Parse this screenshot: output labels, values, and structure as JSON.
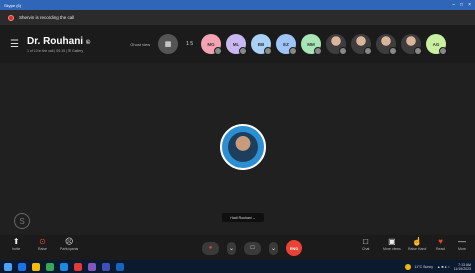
{
  "window": {
    "title": "Skype (6)"
  },
  "recording": {
    "text": "Shervin is recording the call"
  },
  "header": {
    "title": "Dr. Rouhani",
    "title_suffix": "©",
    "subtitle": "1 of 10 in the call | 00:15 | ☰ Gallery",
    "ghost_text": "Ghost view",
    "participant_count": "1 5",
    "avatars": [
      {
        "initials": "MG",
        "color": "#f4a3b5"
      },
      {
        "initials": "ML",
        "color": "#c9b7f2"
      },
      {
        "initials": "BB",
        "color": "#a9d0f5"
      },
      {
        "initials": "EZ",
        "color": "#9fc5f8"
      },
      {
        "initials": "MM",
        "color": "#a8e6b8"
      },
      {
        "initials": "",
        "color": "photo"
      },
      {
        "initials": "",
        "color": "photo"
      },
      {
        "initials": "",
        "color": "photo"
      },
      {
        "initials": "",
        "color": "photo"
      },
      {
        "initials": "AG",
        "color": "#c8f0a0"
      }
    ]
  },
  "stage": {
    "speaker_name": "Hadi Rouhani",
    "speaker_menu": "⌄",
    "brand_letter": "S"
  },
  "controls": {
    "left": [
      {
        "icon": "share-icon",
        "glyph": "⬆",
        "label": "Invite"
      },
      {
        "icon": "react-icon",
        "glyph": "⊙",
        "label": "Raise"
      },
      {
        "icon": "people-icon",
        "glyph": "☹",
        "label": "Participants"
      }
    ],
    "middle": {
      "mic": "●",
      "mic_menu": "⌄",
      "cam": "□",
      "cam_menu": "⌄",
      "end_label": "END"
    },
    "right": [
      {
        "icon": "chat-icon",
        "glyph": "□",
        "label": "Chat"
      },
      {
        "icon": "more-view-icon",
        "glyph": "▣",
        "label": "More views"
      },
      {
        "icon": "raise-hand-icon",
        "glyph": "☝",
        "label": "Raise Hand"
      },
      {
        "icon": "heart-icon",
        "glyph": "♥",
        "label": "React"
      },
      {
        "icon": "more-icon",
        "glyph": "—",
        "label": "More"
      }
    ]
  },
  "taskbar": {
    "weather": "11°C Sunny",
    "time": "7:13 AM",
    "date": "11/19/2023",
    "apps": [
      "#1a73e8",
      "#fbbc04",
      "#34a853",
      "#1e88e5",
      "#e53935",
      "#7e57c2",
      "#3f51b5",
      "#1565c0"
    ]
  }
}
